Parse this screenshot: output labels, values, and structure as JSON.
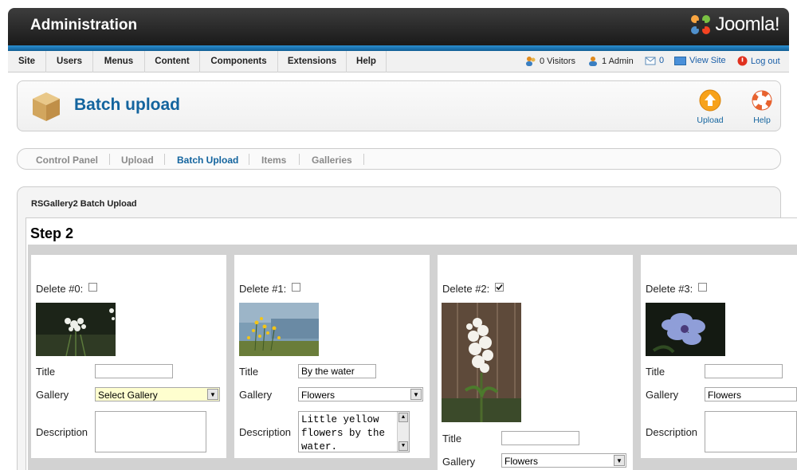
{
  "header": {
    "title": "Administration",
    "logo_text": "Joomla!"
  },
  "menu": {
    "items": [
      "Site",
      "Users",
      "Menus",
      "Content",
      "Components",
      "Extensions",
      "Help"
    ]
  },
  "status": {
    "visitors": "0 Visitors",
    "admins": "1 Admin",
    "messages": "0",
    "view_site": "View Site",
    "logout": "Log out"
  },
  "toolbar": {
    "page_title": "Batch upload",
    "upload_label": "Upload",
    "help_label": "Help"
  },
  "submenu": {
    "items": [
      "Control Panel",
      "Upload",
      "Batch Upload",
      "Items",
      "Galleries"
    ],
    "active": "Batch Upload"
  },
  "panel": {
    "title": "RSGallery2 Batch Upload",
    "step_title": "Step 2"
  },
  "labels": {
    "title": "Title",
    "gallery": "Gallery",
    "description": "Description"
  },
  "items": [
    {
      "delete_label": "Delete #0:",
      "delete_checked": false,
      "title": "",
      "gallery": "Select Gallery",
      "description": "",
      "image": "white-flowers"
    },
    {
      "delete_label": "Delete #1:",
      "delete_checked": false,
      "title": "By the water",
      "gallery": "Flowers",
      "description": "Little yellow flowers by the water.",
      "image": "yellow-flowers-by-water"
    },
    {
      "delete_label": "Delete #2:",
      "delete_checked": true,
      "title": "",
      "gallery": "Flowers",
      "description": "",
      "image": "white-hydrangea"
    },
    {
      "delete_label": "Delete #3:",
      "delete_checked": false,
      "title": "",
      "gallery": "Flowers",
      "description": "",
      "image": "blue-hibiscus"
    }
  ],
  "colors": {
    "accent": "#13649e",
    "header_dark": "#1a1a1a",
    "header_blue": "#2a8fd0",
    "highlight_select": "#fefecf"
  }
}
